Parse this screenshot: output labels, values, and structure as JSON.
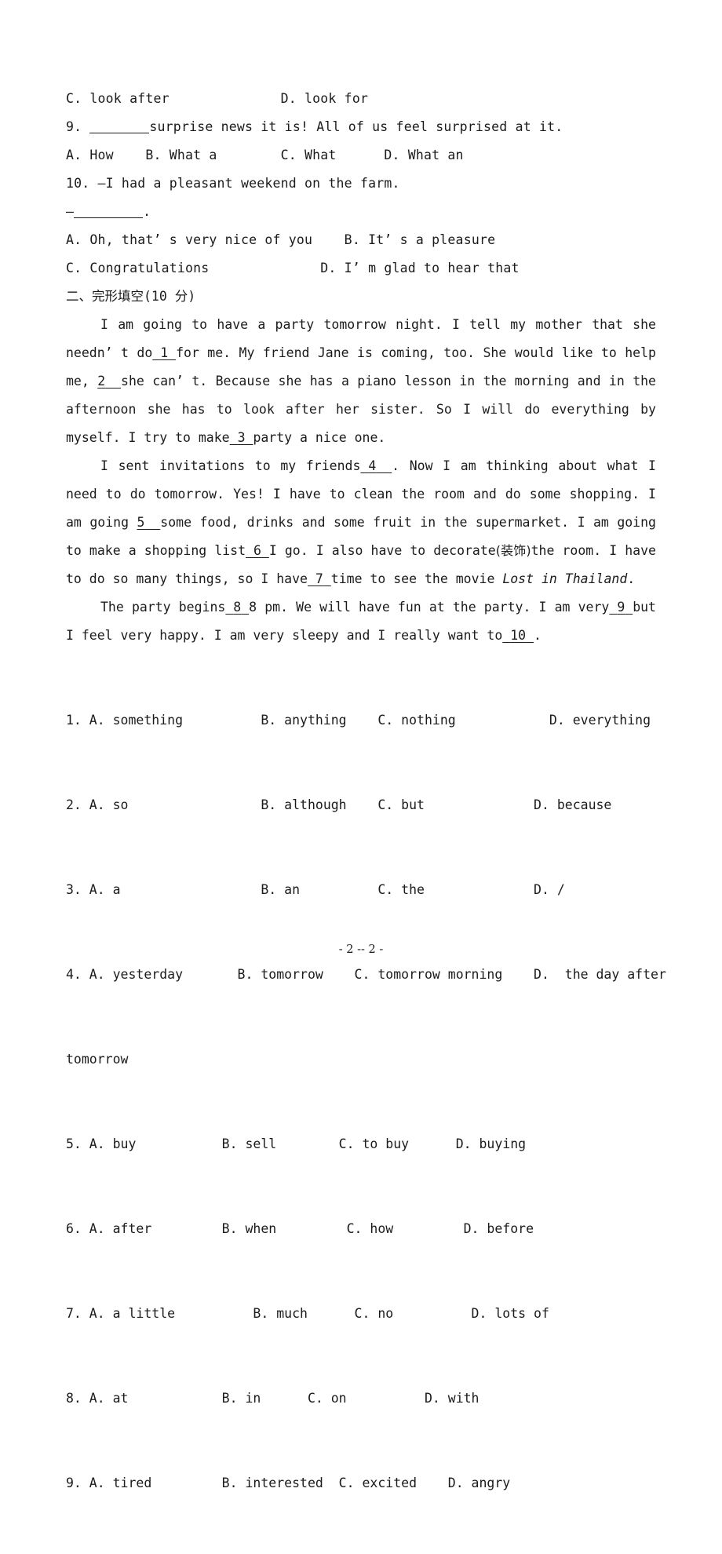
{
  "document": {
    "page_footer": "- 2 -- 2 -"
  },
  "top_questions": {
    "q8_options_line": "C. look after              D. look for",
    "q9": {
      "stem_prefix": "9. ",
      "blank": "",
      "stem_rest": "surprise news it is! All of us feel surprised at it.",
      "options_line": "A. How    B. What a        C. What      D. What an"
    },
    "q10": {
      "stem_line": "10. —I had a pleasant weekend on the farm.",
      "answer_dash": "—",
      "answer_blank": "",
      "answer_period": ".",
      "options_line_1": "A. Oh, that’ s very nice of you    B. It’ s a pleasure",
      "options_line_2": "C. Congratulations              D. I’ m glad to hear that"
    }
  },
  "section": {
    "number": "二、",
    "title": "完形填空",
    "score": "(10 分)"
  },
  "passage": {
    "p1": {
      "t1": "I am going to have a party tomorrow night. I tell my mother that she needn’ t do",
      "b1": "1",
      "t2": "for me. My friend Jane is coming, too. She would like to help me,",
      "b2": "2",
      "t3": "she can’ t. Because she has a piano lesson in the morning and in the afternoon she has to look after her sister. So I will do everything by myself. I try to make",
      "b3": "3",
      "t4": "party a nice one."
    },
    "p2": {
      "t1": "I sent invitations to my friends",
      "b4": "4",
      "t2": ". Now I am thinking about what I need to do tomorrow. Yes! I have to clean the room and do some shopping. I am going",
      "b5": "5",
      "t3": "some food, drinks and some fruit in the supermarket. I am going to make a shopping list",
      "b6": "6",
      "t4": "I go. I also have to decorate",
      "cn_gloss": "(装饰)",
      "t5": "the room. I have to do so many things, so I have",
      "b7": "7",
      "t6": "time to see the movie ",
      "movie_title": "Lost in Thailand",
      "t7": "."
    },
    "p3": {
      "t1": "The party begins",
      "b8": "8",
      "t2": "8 pm. We will have fun at the party. I am very",
      "b9": "9",
      "t3": "but I feel very happy. I am very sleepy and I really want to",
      "b10": "10",
      "t4": "."
    }
  },
  "answer_options": [
    {
      "num": "1.",
      "line": "1. A. something          B. anything    C. nothing            D. everything"
    },
    {
      "num": "2.",
      "line": "2. A. so                 B. although    C. but              D. because"
    },
    {
      "num": "3.",
      "line": "3. A. a                  B. an          C. the              D. /"
    },
    {
      "num": "4.",
      "line": "4. A. yesterday       B. tomorrow    C. tomorrow morning    D.  the day after",
      "wrap": "tomorrow"
    },
    {
      "num": "5.",
      "line": "5. A. buy           B. sell        C. to buy      D. buying"
    },
    {
      "num": "6.",
      "line": "6. A. after         B. when         C. how         D. before"
    },
    {
      "num": "7.",
      "line": "7. A. a little          B. much      C. no          D. lots of"
    },
    {
      "num": "8.",
      "line": "8. A. at            B. in      C. on          D. with"
    },
    {
      "num": "9.",
      "line": "9. A. tired         B. interested  C. excited    D. angry"
    }
  ]
}
